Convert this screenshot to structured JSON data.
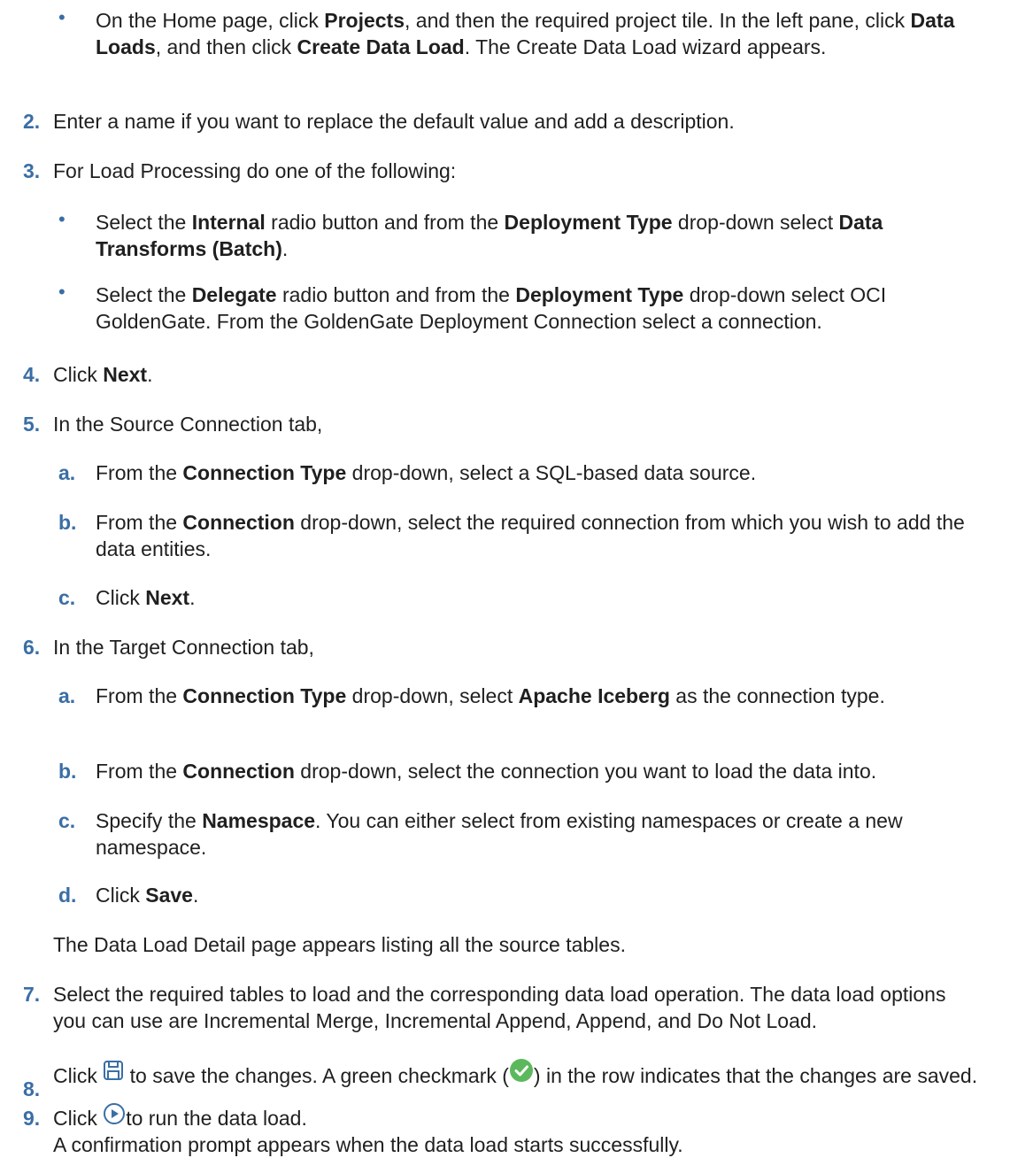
{
  "bullets_top": [
    {
      "parts": [
        "On the Home page, click ",
        "Projects",
        ", and then the required project tile. In the left pane, click ",
        "Data Loads",
        ", and then click ",
        "Create Data Load",
        ". The Create Data Load wizard appears."
      ]
    }
  ],
  "steps": {
    "s2": {
      "num": "2.",
      "text": "Enter a name if you want to replace the default value and add a description."
    },
    "s3": {
      "num": "3.",
      "text": "For Load Processing do one of the following:"
    },
    "s3_b1": {
      "p1": "Select the ",
      "b1": "Internal",
      "p2": " radio button and from the ",
      "b2": "Deployment Type",
      "p3": " drop-down select ",
      "b3": "Data Transforms (Batch)",
      "p4": "."
    },
    "s3_b2": {
      "p1": "Select the ",
      "b1": "Delegate",
      "p2": " radio button and from the ",
      "b2": "Deployment Type",
      "p3": " drop-down select OCI GoldenGate. From the GoldenGate Deployment Connection select a connection."
    },
    "s4": {
      "num": "4.",
      "p1": "Click ",
      "b1": "Next",
      "p2": "."
    },
    "s5": {
      "num": "5.",
      "text": "In the Source Connection tab,"
    },
    "s5a": {
      "num": "a.",
      "p1": "From the ",
      "b1": "Connection Type",
      "p2": " drop-down, select a SQL-based data source."
    },
    "s5b": {
      "num": "b.",
      "p1": "From the ",
      "b1": "Connection",
      "p2": " drop-down, select the required connection from which you wish to add the data entities."
    },
    "s5c": {
      "num": "c.",
      "p1": "Click ",
      "b1": "Next",
      "p2": "."
    },
    "s6": {
      "num": "6.",
      "text": "In the Target Connection tab,"
    },
    "s6a": {
      "num": "a.",
      "p1": "From the ",
      "b1": "Connection Type",
      "p2": " drop-down, select ",
      "b2": "Apache Iceberg",
      "p3": " as the connection type."
    },
    "s6b": {
      "num": "b.",
      "p1": "From the ",
      "b1": "Connection",
      "p2": " drop-down, select the connection you want to load the data into."
    },
    "s6c": {
      "num": "c.",
      "p1": "Specify the ",
      "b1": "Namespace",
      "p2": ". You can either select from existing namespaces or create a new namespace."
    },
    "s6d": {
      "num": "d.",
      "p1": "Click ",
      "b1": "Save",
      "p2": "."
    },
    "s6_result": "The Data Load Detail page appears listing all the source tables.",
    "s7": {
      "num": "7.",
      "text": "Select the required tables to load and the corresponding data load operation. The data load options you can use are Incremental Merge, Incremental Append, Append, and Do Not Load."
    },
    "s8": {
      "num": "8.",
      "p1": "Click ",
      "p2": " to save the changes. A green checkmark (",
      "p3": ") in the row indicates that the changes are saved."
    },
    "s9": {
      "num": "9.",
      "p1": "Click ",
      "p2": "to run the data load.",
      "line2": "A confirmation prompt appears when the data load starts successfully."
    }
  },
  "icons": {
    "save": "save-icon",
    "check": "green-checkmark-icon",
    "run": "run-play-icon",
    "accent": "#3a6ea5",
    "check_color": "#5cb85c"
  }
}
